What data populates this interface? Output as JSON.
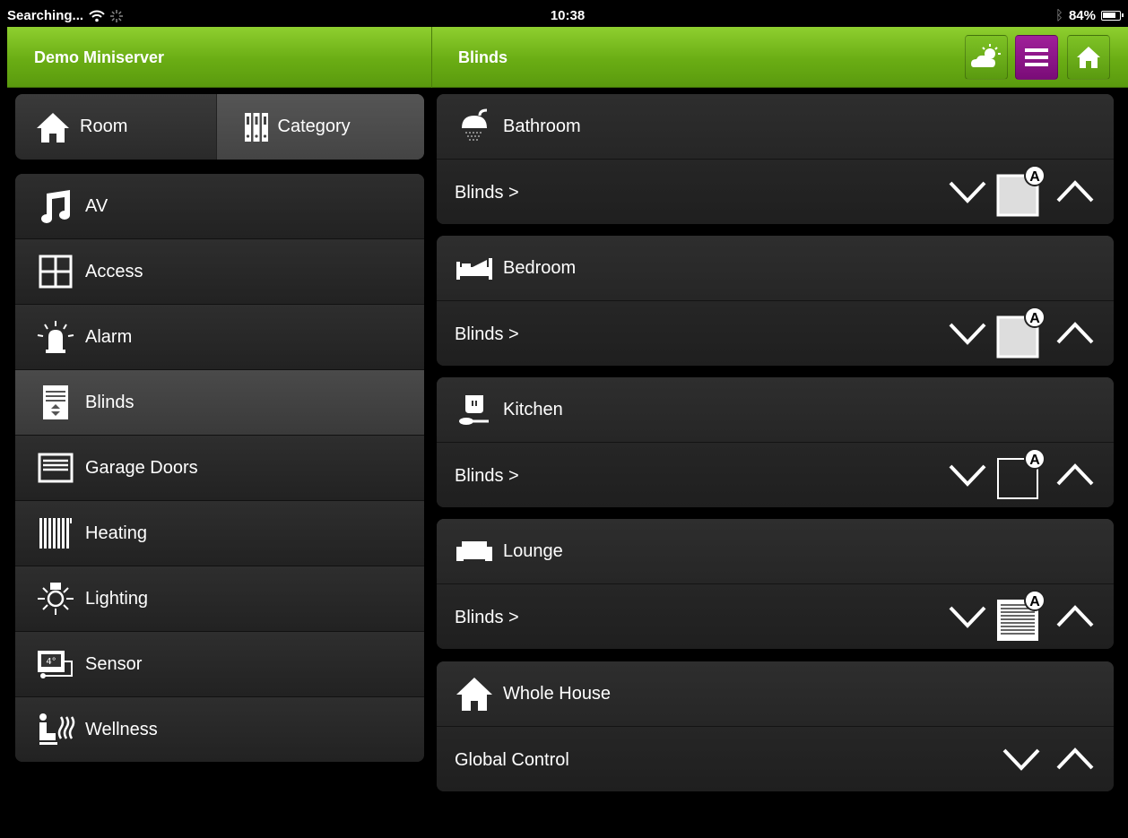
{
  "status": {
    "carrier": "Searching...",
    "time": "10:38",
    "battery": "84%"
  },
  "header": {
    "left_title": "Demo Miniserver",
    "right_title": "Blinds"
  },
  "segment": {
    "room_label": "Room",
    "category_label": "Category"
  },
  "categories": [
    {
      "label": "AV",
      "icon": "music-note-icon"
    },
    {
      "label": "Access",
      "icon": "window-icon"
    },
    {
      "label": "Alarm",
      "icon": "siren-icon"
    },
    {
      "label": "Blinds",
      "icon": "blinds-icon"
    },
    {
      "label": "Garage Doors",
      "icon": "garage-icon"
    },
    {
      "label": "Heating",
      "icon": "radiator-icon"
    },
    {
      "label": "Lighting",
      "icon": "lamp-icon"
    },
    {
      "label": "Sensor",
      "icon": "thermometer-display-icon"
    },
    {
      "label": "Wellness",
      "icon": "wellness-icon"
    }
  ],
  "selected_category": "Blinds",
  "rooms": [
    {
      "name": "Bathroom",
      "control": "Blinds >",
      "blind_state": "closed"
    },
    {
      "name": "Bedroom",
      "control": "Blinds >",
      "blind_state": "closed"
    },
    {
      "name": "Kitchen",
      "control": "Blinds >",
      "blind_state": "open"
    },
    {
      "name": "Lounge",
      "control": "Blinds >",
      "blind_state": "slatted"
    },
    {
      "name": "Whole House",
      "control": "Global Control",
      "blind_state": "none"
    }
  ],
  "auto_badge": "A",
  "colors": {
    "header_green": "#6aad14",
    "menu_purple": "#8a1488"
  }
}
